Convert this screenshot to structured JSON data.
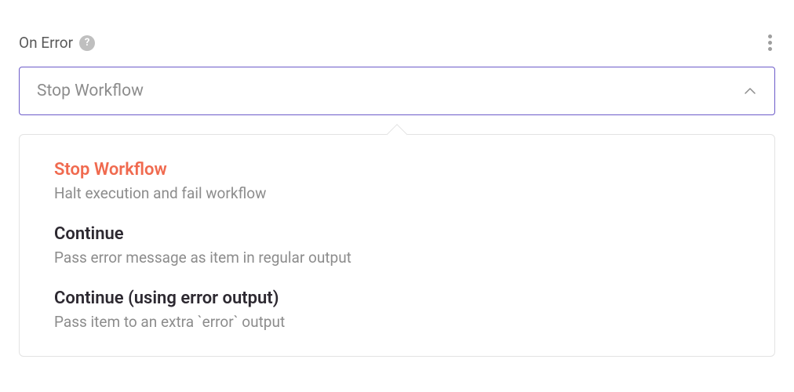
{
  "field": {
    "label": "On Error",
    "selected_value": "Stop Workflow"
  },
  "options": [
    {
      "title": "Stop Workflow",
      "desc": "Halt execution and fail workflow",
      "selected": true
    },
    {
      "title": "Continue",
      "desc": "Pass error message as item in regular output",
      "selected": false
    },
    {
      "title": "Continue (using error output)",
      "desc": "Pass item to an extra `error` output",
      "selected": false
    }
  ]
}
